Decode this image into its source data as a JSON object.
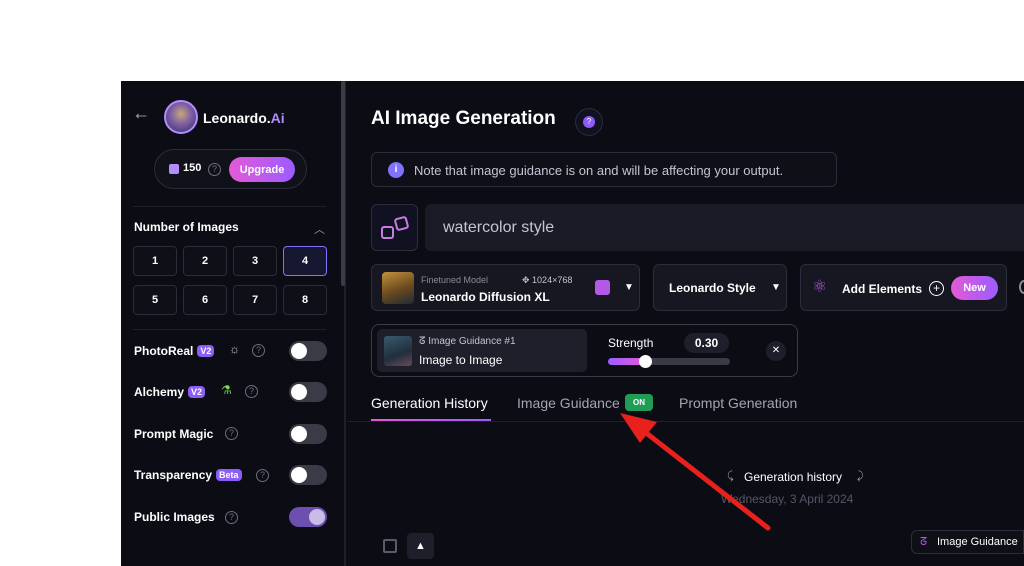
{
  "sidebar": {
    "brand": {
      "name": "Leonardo.",
      "suffix": "Ai"
    },
    "credits": {
      "count": "150",
      "upgrade_label": "Upgrade"
    },
    "num_images": {
      "title": "Number of Images",
      "options": [
        "1",
        "2",
        "3",
        "4",
        "5",
        "6",
        "7",
        "8"
      ],
      "selected": "4"
    },
    "toggles": [
      {
        "label": "PhotoReal",
        "badge": "V2",
        "on": false
      },
      {
        "label": "Alchemy",
        "badge": "V2",
        "on": false
      },
      {
        "label": "Prompt Magic",
        "badge": "",
        "on": false
      },
      {
        "label": "Transparency",
        "badge": "Beta",
        "on": false
      },
      {
        "label": "Public Images",
        "badge": "",
        "on": true
      }
    ]
  },
  "main": {
    "title": "AI Image Generation",
    "notice": "Note that image guidance is on and will be affecting your output.",
    "prompt_value": "watercolor style",
    "model": {
      "caption": "Finetuned Model",
      "dims": "1024×768",
      "name": "Leonardo Diffusion XL"
    },
    "style": {
      "label": "Leonardo Style"
    },
    "elements": {
      "label": "Add Elements",
      "new_label": "New"
    },
    "guidance": {
      "caption": "Image Guidance #1",
      "name": "Image to Image",
      "strength_label": "Strength",
      "strength_value": "0.30",
      "strength_fraction": 0.3
    },
    "tabs": [
      {
        "label": "Generation History",
        "active": true
      },
      {
        "label": "Image Guidance",
        "active": false,
        "badge": "ON"
      },
      {
        "label": "Prompt Generation",
        "active": false
      }
    ],
    "history": {
      "title": "Generation history",
      "date": "Wednesday, 3 April 2024"
    },
    "image_guidance_chip": "Image Guidance"
  },
  "colors": {
    "accent": "#9b5cff",
    "pink": "#e45ad7",
    "bg": "#0b0c14",
    "on_green": "#1f9d55",
    "arrow": "#e8211d"
  }
}
